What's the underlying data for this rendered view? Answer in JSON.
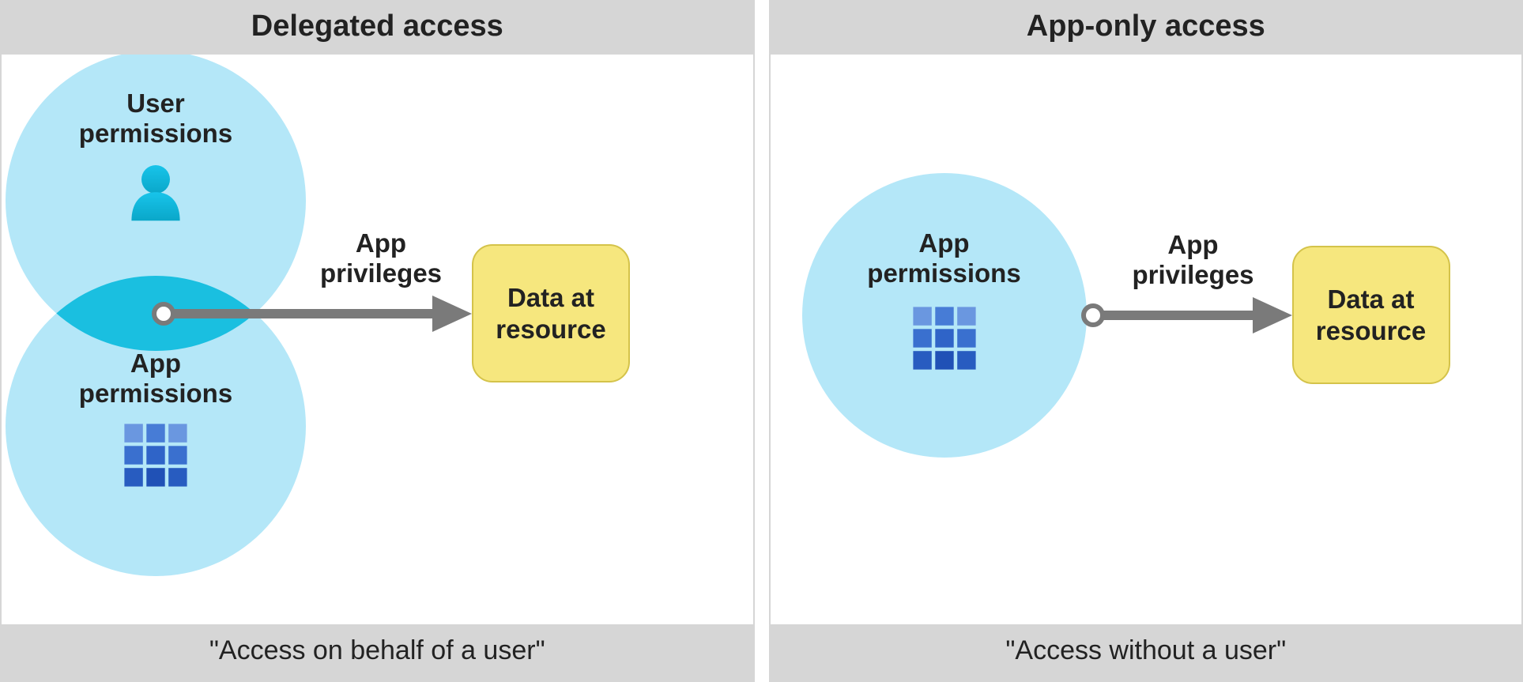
{
  "left": {
    "title": "Delegated access",
    "footer": "\"Access on behalf of a user\"",
    "userCircleLabel": "User\npermissions",
    "appCircleLabel": "App\npermissions",
    "arrowLabel": "App\nprivileges",
    "dataBox": "Data at\nresource"
  },
  "right": {
    "title": "App-only access",
    "footer": "\"Access without a user\"",
    "appCircleLabel": "App\npermissions",
    "arrowLabel": "App\nprivileges",
    "dataBox": "Data at\nresource"
  },
  "colors": {
    "circleLight": "#b4e7f8",
    "circleDark": "#18bfe2",
    "gridBlue": "#2f6dd0",
    "gridBlueLight": "#5f8ede",
    "arrowGray": "#7a7a7a",
    "boxFill": "#f6e77e",
    "boxBorder": "#d4c34a",
    "panelGray": "#d6d6d6"
  }
}
